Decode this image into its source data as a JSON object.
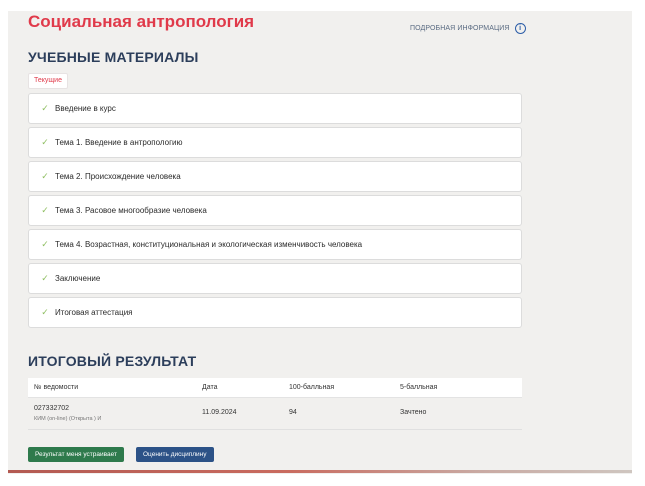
{
  "header": {
    "course_title": "Социальная антропология",
    "info_link_label": "ПОДРОБНАЯ ИНФОРМАЦИЯ",
    "info_icon_glyph": "i"
  },
  "materials": {
    "heading": "УЧЕБНЫЕ МАТЕРИАЛЫ",
    "tab_current": "Текущие",
    "modules": [
      {
        "label": "Введение в курс",
        "completed": true
      },
      {
        "label": "Тема 1. Введение в антропологию",
        "completed": true
      },
      {
        "label": "Тема 2. Происхождение человека",
        "completed": true
      },
      {
        "label": "Тема 3. Расовое многообразие человека",
        "completed": true
      },
      {
        "label": "Тема 4. Возрастная, конституциональная и экологическая изменчивость человека",
        "completed": true
      },
      {
        "label": "Заключение",
        "completed": true
      },
      {
        "label": "Итоговая аттестация",
        "completed": true
      }
    ],
    "check_glyph": "✓"
  },
  "result": {
    "heading": "ИТОГОВЫЙ РЕЗУЛЬТАТ",
    "columns": [
      "№ ведомости",
      "Дата",
      "100-балльная",
      "5-балльная"
    ],
    "rows": [
      {
        "statement_no": "027332702",
        "statement_note": "КИМ (on-line) (Открыта ) И",
        "date": "11.09.2024",
        "score_100": "94",
        "score_5": "Зачтено"
      }
    ]
  },
  "actions": {
    "accept_label": "Результат меня устраивает",
    "rate_label": "Оценить дисциплину"
  },
  "colors": {
    "brand_red": "#e03a4a",
    "heading_navy": "#2c3e5b",
    "check_green": "#8fbf62",
    "accept_green": "#2e7a4c",
    "rate_blue": "#2c5287"
  }
}
